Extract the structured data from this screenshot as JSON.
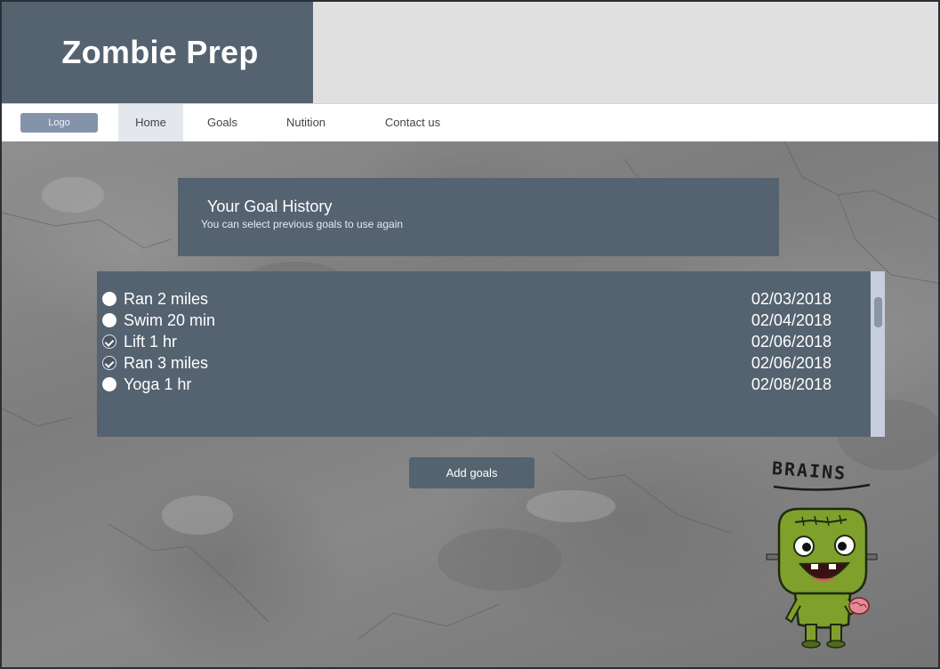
{
  "header": {
    "title": "Zombie Prep"
  },
  "nav": {
    "logo_label": "Logo",
    "items": [
      {
        "label": "Home",
        "active": true
      },
      {
        "label": "Goals",
        "active": false
      },
      {
        "label": "Nutition",
        "active": false
      },
      {
        "label": "Contact us",
        "active": false
      }
    ]
  },
  "history": {
    "title": "Your Goal History",
    "subtitle": "You can select previous goals to use again"
  },
  "goals": [
    {
      "name": "Ran 2 miles",
      "date": "02/03/2018",
      "checked": false
    },
    {
      "name": "Swim 20 min",
      "date": "02/04/2018",
      "checked": false
    },
    {
      "name": "Lift 1 hr",
      "date": "02/06/2018",
      "checked": true
    },
    {
      "name": "Ran 3 miles",
      "date": "02/06/2018",
      "checked": true
    },
    {
      "name": "Yoga 1 hr",
      "date": "02/08/2018",
      "checked": false
    }
  ],
  "actions": {
    "add_goals_label": "Add goals"
  },
  "illustration": {
    "caption": "BRAINS",
    "icon": "zombie-illustration"
  },
  "colors": {
    "primary": "#556270",
    "nav_active": "#e4e7ee",
    "logo_button": "#8593aa",
    "scroll_track": "#c7cfdc"
  }
}
